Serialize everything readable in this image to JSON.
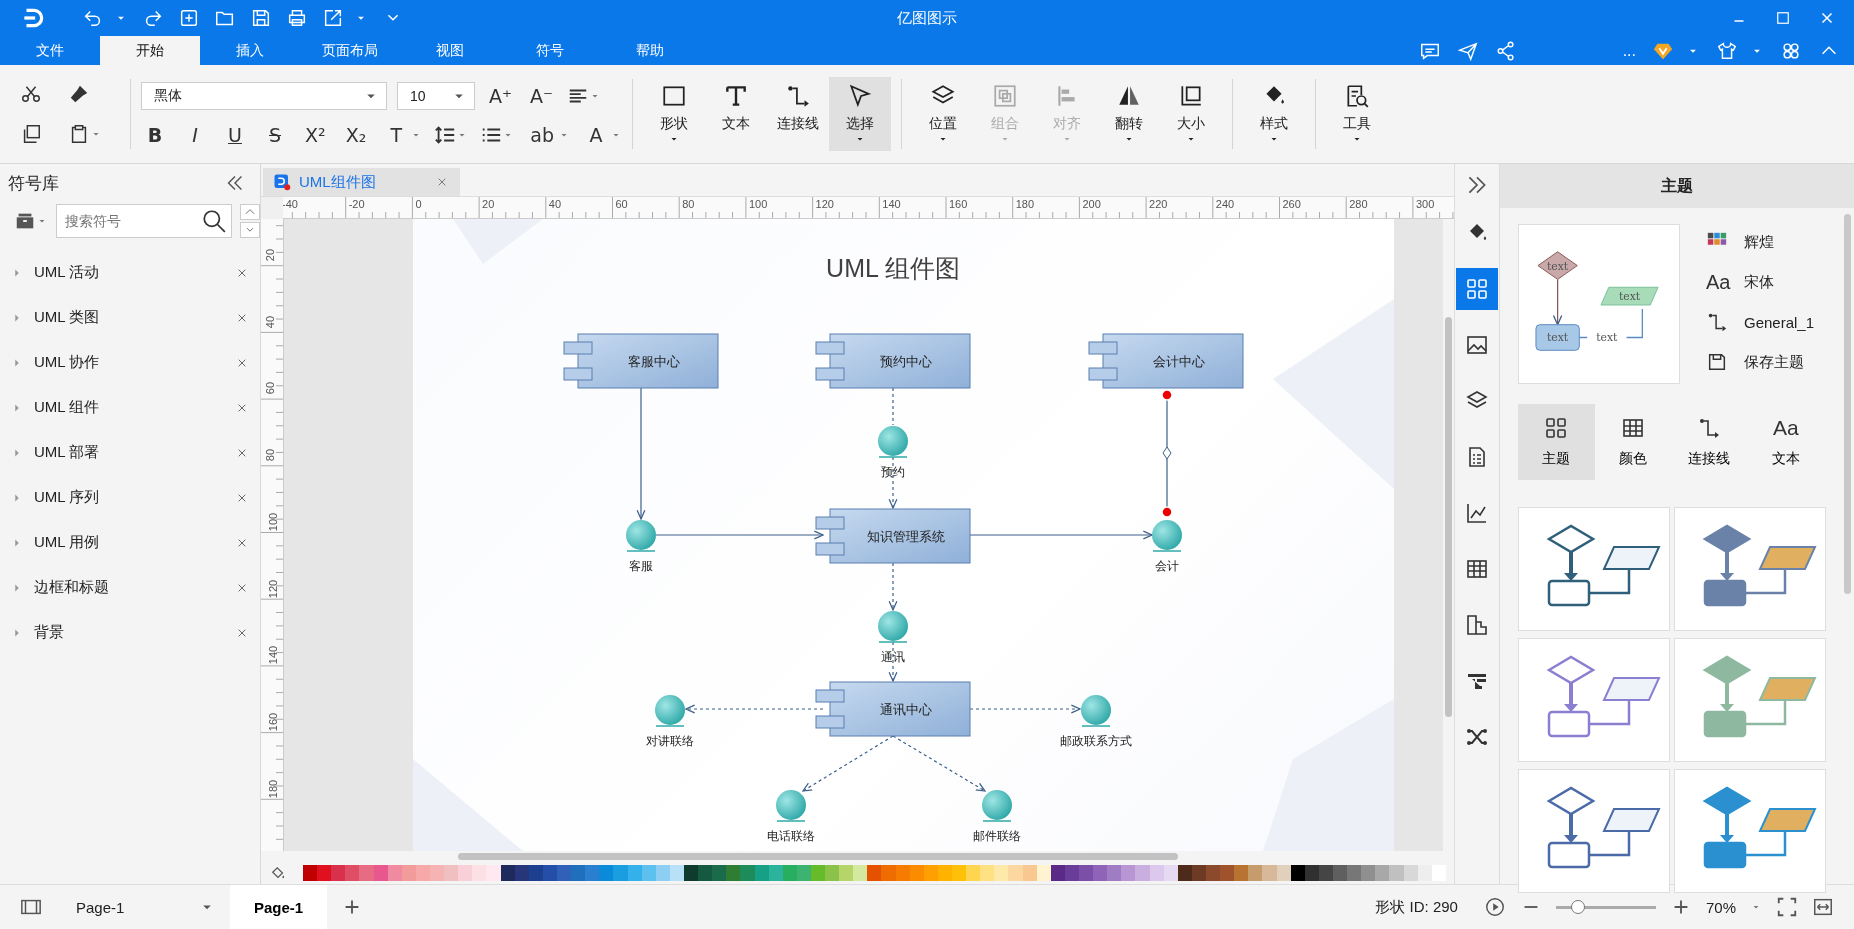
{
  "window": {
    "title": "亿图图示"
  },
  "menu_tabs": [
    {
      "label": "文件",
      "selected": false
    },
    {
      "label": "开始",
      "selected": true
    },
    {
      "label": "插入",
      "selected": false
    },
    {
      "label": "页面布局",
      "selected": false
    },
    {
      "label": "视图",
      "selected": false
    },
    {
      "label": "符号",
      "selected": false
    },
    {
      "label": "帮助",
      "selected": false
    }
  ],
  "account": {
    "more": "..."
  },
  "ribbon": {
    "font": "黑体",
    "size": "10",
    "format_buttons": [
      {
        "text": "B",
        "dropdown": false
      },
      {
        "text": "I",
        "dropdown": false
      },
      {
        "text": "U",
        "dropdown": false
      },
      {
        "text": "S",
        "dropdown": false
      },
      {
        "text": "X²",
        "dropdown": false
      },
      {
        "text": "X₂",
        "dropdown": false
      },
      {
        "text": "T",
        "dropdown": true
      }
    ],
    "format_buttons_2": [
      {
        "text": "ab",
        "dropdown": true
      },
      {
        "text": "A",
        "dropdown": true
      }
    ],
    "grow_buttons": [
      {
        "text": "A⁺"
      },
      {
        "text": "A⁻"
      }
    ],
    "big_buttons": [
      {
        "label": "形状",
        "selected": false,
        "disabled": false,
        "dropdown": true
      },
      {
        "label": "文本",
        "selected": false,
        "disabled": false,
        "dropdown": false
      },
      {
        "label": "连接线",
        "selected": false,
        "disabled": false,
        "dropdown": false
      },
      {
        "label": "选择",
        "selected": true,
        "disabled": false,
        "dropdown": true
      },
      {
        "label": "位置",
        "selected": false,
        "disabled": false,
        "dropdown": true
      },
      {
        "label": "组合",
        "selected": false,
        "disabled": true,
        "dropdown": true
      },
      {
        "label": "对齐",
        "selected": false,
        "disabled": true,
        "dropdown": true
      },
      {
        "label": "翻转",
        "selected": false,
        "disabled": false,
        "dropdown": true
      },
      {
        "label": "大小",
        "selected": false,
        "disabled": false,
        "dropdown": true
      },
      {
        "label": "样式",
        "selected": false,
        "disabled": false,
        "dropdown": true
      },
      {
        "label": "工具",
        "selected": false,
        "disabled": false,
        "dropdown": true
      }
    ]
  },
  "left_panel": {
    "title": "符号库",
    "search_placeholder": "搜索符号",
    "libraries": [
      "UML 活动",
      "UML 类图",
      "UML 协作",
      "UML 组件",
      "UML 部署",
      "UML 序列",
      "UML 用例",
      "边框和标题",
      "背景"
    ]
  },
  "document_tab": {
    "label": "UML组件图"
  },
  "ruler": {
    "horizontal": [
      "-40",
      "-20",
      "0",
      "20",
      "40",
      "60",
      "80",
      "100",
      "120",
      "140",
      "160",
      "180",
      "200",
      "220",
      "240",
      "260",
      "280",
      "300"
    ],
    "vertical": [
      "20",
      "40",
      "60",
      "80",
      "100",
      "120",
      "140",
      "160",
      "180"
    ]
  },
  "diagram": {
    "title": "UML 组件图",
    "components": [
      "客服中心",
      "预约中心",
      "会计中心",
      "知识管理系统",
      "通讯中心"
    ],
    "interfaces": [
      "预约",
      "客服",
      "会计",
      "通讯",
      "对讲联络",
      "邮政联系方式",
      "电话联络",
      "邮件联络"
    ]
  },
  "palette": [
    {
      "color": "#c00000"
    },
    {
      "color": "#e0101e"
    },
    {
      "color": "#d9304b"
    },
    {
      "color": "#e04e65"
    },
    {
      "color": "#e76b82"
    },
    {
      "color": "#e8588e"
    },
    {
      "color": "#f08aa0"
    },
    {
      "color": "#f29b9b"
    },
    {
      "color": "#f7a8a8"
    },
    {
      "color": "#f6b3b3"
    },
    {
      "color": "#f0c0c0"
    },
    {
      "color": "#fad0d8"
    },
    {
      "color": "#fde0e6"
    },
    {
      "color": "#ffe8ef"
    },
    {
      "color": "#1f2a5c"
    },
    {
      "color": "#27367a"
    },
    {
      "color": "#1d3f8f"
    },
    {
      "color": "#244ea8"
    },
    {
      "color": "#3060b8"
    },
    {
      "color": "#1f6fbd"
    },
    {
      "color": "#2a7fd0"
    },
    {
      "color": "#0a8ad8"
    },
    {
      "color": "#1a9ee0"
    },
    {
      "color": "#34b0ea"
    },
    {
      "color": "#5ec0ef"
    },
    {
      "color": "#8ccff2"
    },
    {
      "color": "#b8e0f6"
    },
    {
      "color": "#0e3b2e"
    },
    {
      "color": "#155a40"
    },
    {
      "color": "#1a6b4a"
    },
    {
      "color": "#2e7d32"
    },
    {
      "color": "#1e8c5a"
    },
    {
      "color": "#16a085"
    },
    {
      "color": "#2bb39b"
    },
    {
      "color": "#27ae60"
    },
    {
      "color": "#3cb371"
    },
    {
      "color": "#66bb2a"
    },
    {
      "color": "#8bc34a"
    },
    {
      "color": "#b5d56a"
    },
    {
      "color": "#d4e8a0"
    },
    {
      "color": "#e65100"
    },
    {
      "color": "#ef6c00"
    },
    {
      "color": "#f57c00"
    },
    {
      "color": "#fb8c00"
    },
    {
      "color": "#ffa000"
    },
    {
      "color": "#ffb300"
    },
    {
      "color": "#ffc107"
    },
    {
      "color": "#ffd54f"
    },
    {
      "color": "#ffe082"
    },
    {
      "color": "#ffe9a8"
    },
    {
      "color": "#fcd8a0"
    },
    {
      "color": "#f8c890"
    },
    {
      "color": "#fff3d0"
    },
    {
      "color": "#5b2a86"
    },
    {
      "color": "#6a3d9a"
    },
    {
      "color": "#7b4fa8"
    },
    {
      "color": "#8e63b8"
    },
    {
      "color": "#a07cc5"
    },
    {
      "color": "#b896d4"
    },
    {
      "color": "#c9aee0"
    },
    {
      "color": "#dcc8ec"
    },
    {
      "color": "#e6d9f2"
    },
    {
      "color": "#4e2a1a"
    },
    {
      "color": "#6d3b24"
    },
    {
      "color": "#8b4a2b"
    },
    {
      "color": "#a0522d"
    },
    {
      "color": "#b87333"
    },
    {
      "color": "#c69c6d"
    },
    {
      "color": "#d7b899"
    },
    {
      "color": "#e0d0bc"
    },
    {
      "color": "#000000"
    },
    {
      "color": "#303030"
    },
    {
      "color": "#454545"
    },
    {
      "color": "#5f5f5f"
    },
    {
      "color": "#777777"
    },
    {
      "color": "#8f8f8f"
    },
    {
      "color": "#a8a8a8"
    },
    {
      "color": "#c0c0c0"
    },
    {
      "color": "#d8d8d8"
    },
    {
      "color": "#eeeeee"
    },
    {
      "color": "#ffffff"
    }
  ],
  "side_toolbar": [
    {
      "selected": false
    },
    {
      "selected": true
    },
    {
      "selected": false
    },
    {
      "selected": false
    },
    {
      "selected": false
    },
    {
      "selected": false
    },
    {
      "selected": false
    },
    {
      "selected": false
    },
    {
      "selected": false
    },
    {
      "selected": false
    }
  ],
  "right_panel": {
    "title": "主题",
    "preview_texts": [
      "text",
      "text",
      "text",
      "text"
    ],
    "options": [
      {
        "label": "辉煌"
      },
      {
        "label": "宋体",
        "glyph": "Aa"
      },
      {
        "label": "General_1"
      },
      {
        "label": "保存主题"
      }
    ],
    "tabs": [
      {
        "label": "主题",
        "selected": true
      },
      {
        "label": "颜色",
        "selected": false
      },
      {
        "label": "连接线",
        "selected": false
      },
      {
        "label": "文本",
        "selected": false,
        "glyph": "Aa"
      }
    ],
    "themes": [
      {
        "color": "#2f5f7a",
        "selected": false
      },
      {
        "color": "#6a82a8",
        "selected": false
      },
      {
        "color": "#8a7fd0",
        "selected": false
      },
      {
        "color": "#8fb8a0",
        "selected": false
      },
      {
        "color": "#4a6aa8",
        "selected": false
      },
      {
        "color": "#2a90d0",
        "selected": false
      }
    ]
  },
  "status_bar": {
    "page_selector": "Page-1",
    "page_tab": "Page-1",
    "shape_id": "形状 ID: 290",
    "zoom": "70%",
    "level": 0.22
  }
}
